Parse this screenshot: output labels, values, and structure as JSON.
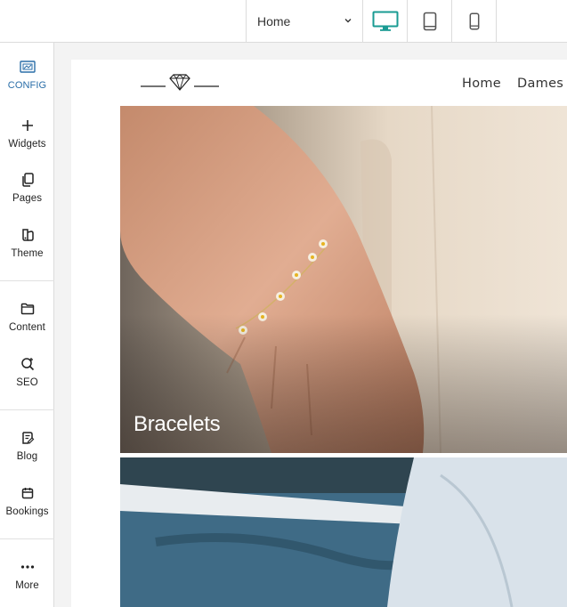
{
  "toolbar": {
    "page_select": {
      "value": "Home"
    },
    "devices": [
      {
        "name": "desktop",
        "active": true
      },
      {
        "name": "tablet",
        "active": false
      },
      {
        "name": "mobile",
        "active": false
      }
    ],
    "active_color": "#1a9b93"
  },
  "sidebar": {
    "items": [
      {
        "label": "CONFIG",
        "icon": "config-icon"
      },
      {
        "label": "Widgets",
        "icon": "plus-icon"
      },
      {
        "label": "Pages",
        "icon": "pages-icon"
      },
      {
        "label": "Theme",
        "icon": "theme-icon"
      },
      {
        "label": "Content",
        "icon": "folder-icon"
      },
      {
        "label": "SEO",
        "icon": "seo-icon"
      },
      {
        "label": "Blog",
        "icon": "blog-icon"
      },
      {
        "label": "Bookings",
        "icon": "calendar-icon"
      },
      {
        "label": "More",
        "icon": "more-icon"
      }
    ]
  },
  "site": {
    "logo": "diamond-logo",
    "nav": {
      "home": "Home",
      "dames": "Dames"
    },
    "hero": {
      "title": "Bracelets"
    }
  }
}
